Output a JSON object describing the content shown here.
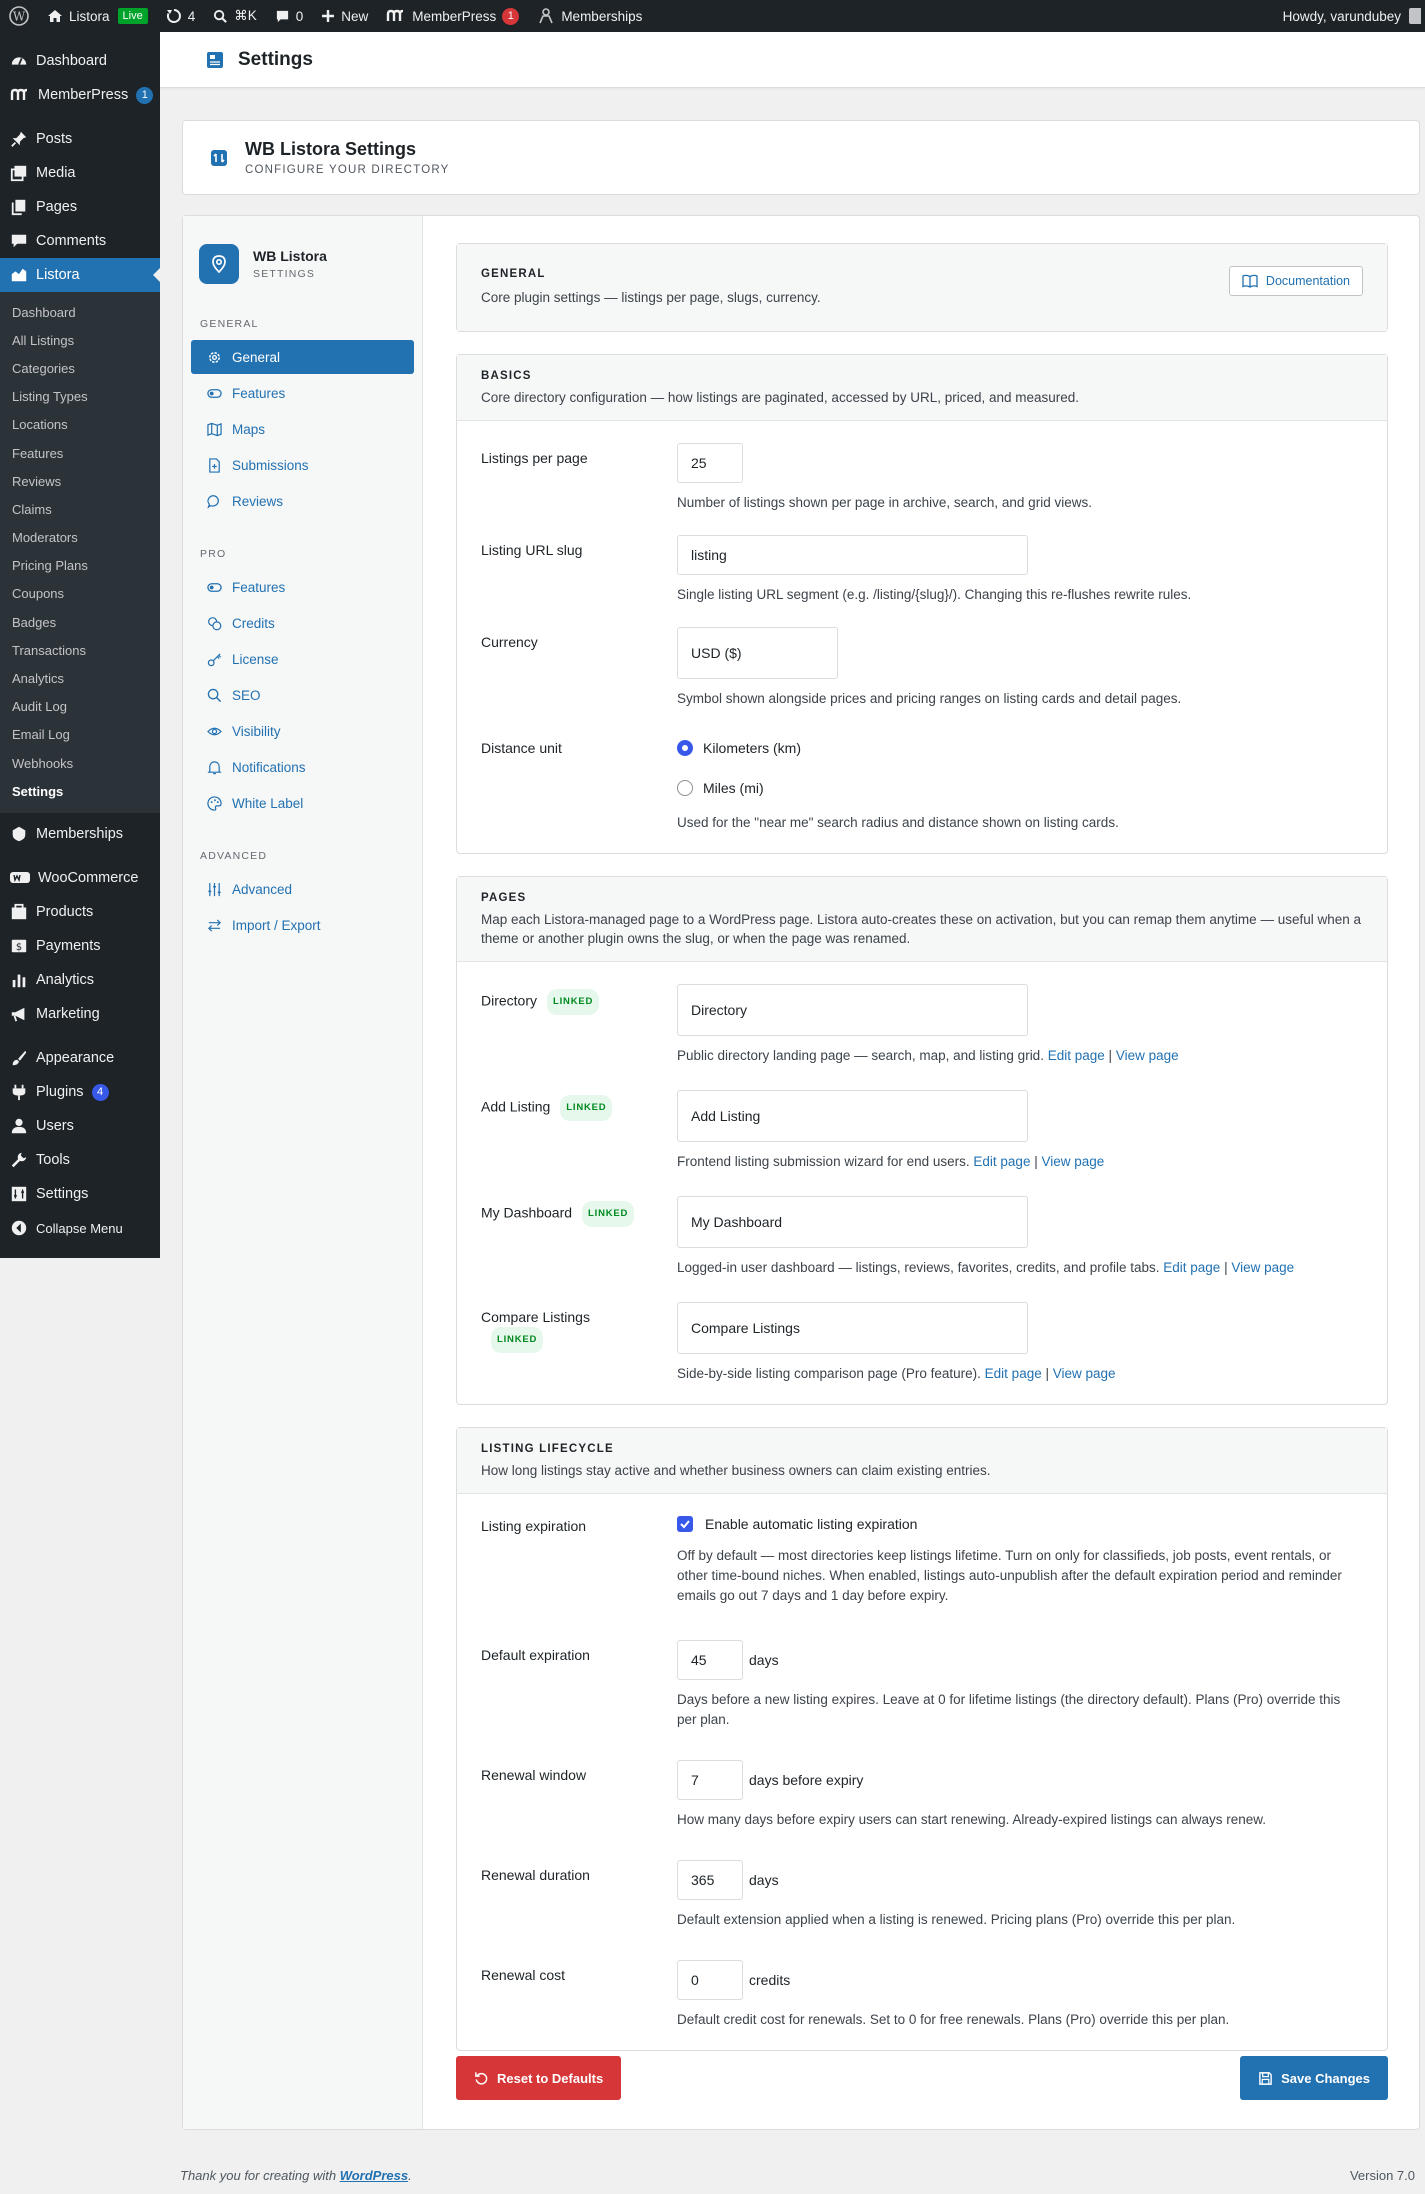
{
  "adminbar": {
    "site_name": "Listora",
    "live_label": "Live",
    "updates_count": "4",
    "search_shortcut": "⌘K",
    "comments_count": "0",
    "new_label": "New",
    "memberpress_label": "MemberPress",
    "memberpress_count": "1",
    "memberships_label": "Memberships",
    "howdy": "Howdy, varundubey"
  },
  "sidebar": {
    "top": [
      {
        "label": "Dashboard",
        "icon": "dashboard-icon"
      },
      {
        "label": "MemberPress",
        "icon": "memberpress-icon",
        "count": "1"
      }
    ],
    "group2": [
      {
        "label": "Posts",
        "icon": "pin-icon"
      },
      {
        "label": "Media",
        "icon": "media-icon"
      },
      {
        "label": "Pages",
        "icon": "pages-icon"
      },
      {
        "label": "Comments",
        "icon": "comment-icon"
      }
    ],
    "listora_label": "Listora",
    "listora_sub": [
      "Dashboard",
      "All Listings",
      "Categories",
      "Listing Types",
      "Locations",
      "Features",
      "Reviews",
      "Claims",
      "Moderators",
      "Pricing Plans",
      "Coupons",
      "Badges",
      "Transactions",
      "Analytics",
      "Audit Log",
      "Email Log",
      "Webhooks",
      "Settings"
    ],
    "current_sub": "Settings",
    "memberships_label": "Memberships",
    "group3": [
      {
        "label": "WooCommerce"
      },
      {
        "label": "Products"
      },
      {
        "label": "Payments"
      },
      {
        "label": "Analytics"
      },
      {
        "label": "Marketing"
      }
    ],
    "group4": [
      {
        "label": "Appearance"
      },
      {
        "label": "Plugins",
        "count": "4"
      },
      {
        "label": "Users"
      },
      {
        "label": "Tools"
      },
      {
        "label": "Settings"
      },
      {
        "label": "Collapse Menu"
      }
    ]
  },
  "page_title": "Settings",
  "plugin_header": {
    "title": "WB Listora Settings",
    "subtitle": "CONFIGURE YOUR DIRECTORY"
  },
  "settings_nav": {
    "title": "WB Listora",
    "subtitle": "SETTINGS",
    "groups": [
      {
        "label": "GENERAL",
        "items": [
          {
            "label": "General",
            "icon": "gear-icon"
          },
          {
            "label": "Features",
            "icon": "toggle-icon"
          },
          {
            "label": "Maps",
            "icon": "map-icon"
          },
          {
            "label": "Submissions",
            "icon": "document-icon"
          },
          {
            "label": "Reviews",
            "icon": "chat-icon"
          }
        ]
      },
      {
        "label": "PRO",
        "items": [
          {
            "label": "Features",
            "icon": "toggle-icon"
          },
          {
            "label": "Credits",
            "icon": "coins-icon"
          },
          {
            "label": "License",
            "icon": "key-icon"
          },
          {
            "label": "SEO",
            "icon": "search-icon"
          },
          {
            "label": "Visibility",
            "icon": "eye-icon"
          },
          {
            "label": "Notifications",
            "icon": "bell-icon"
          },
          {
            "label": "White Label",
            "icon": "palette-icon"
          }
        ]
      },
      {
        "label": "ADVANCED",
        "items": [
          {
            "label": "Advanced",
            "icon": "sliders-icon"
          },
          {
            "label": "Import / Export",
            "icon": "arrows-icon"
          }
        ]
      }
    ],
    "current": "General"
  },
  "general_card": {
    "title": "GENERAL",
    "desc": "Core plugin settings — listings per page, slugs, currency.",
    "doc_label": "Documentation"
  },
  "basics": {
    "title": "BASICS",
    "desc": "Core directory configuration — how listings are paginated, accessed by URL, priced, and measured.",
    "listings_per_page": {
      "label": "Listings per page",
      "value": "25",
      "help": "Number of listings shown per page in archive, search, and grid views."
    },
    "url_slug": {
      "label": "Listing URL slug",
      "value": "listing",
      "help": "Single listing URL segment (e.g. /listing/{slug}/). Changing this re-flushes rewrite rules."
    },
    "currency": {
      "label": "Currency",
      "value": "USD ($)",
      "help": "Symbol shown alongside prices and pricing ranges on listing cards and detail pages."
    },
    "distance": {
      "label": "Distance unit",
      "option_km": "Kilometers (km)",
      "option_mi": "Miles (mi)",
      "selected": "km",
      "help": "Used for the \"near me\" search radius and distance shown on listing cards."
    }
  },
  "pages": {
    "title": "PAGES",
    "desc": "Map each Listora-managed page to a WordPress page. Listora auto-creates these on activation, but you can remap them anytime — useful when a theme or another plugin owns the slug, or when the page was renamed.",
    "badge": "LINKED",
    "edit_link": "Edit page",
    "view_link": "View page",
    "separator": "|",
    "rows": [
      {
        "label": "Directory",
        "value": "Directory",
        "help": "Public directory landing page — search, map, and listing grid."
      },
      {
        "label": "Add Listing",
        "value": "Add Listing",
        "help": "Frontend listing submission wizard for end users."
      },
      {
        "label": "My Dashboard",
        "value": "My Dashboard",
        "help": "Logged-in user dashboard — listings, reviews, favorites, credits, and profile tabs."
      },
      {
        "label": "Compare Listings",
        "value": "Compare Listings",
        "help": "Side-by-side listing comparison page (Pro feature)."
      }
    ]
  },
  "lifecycle": {
    "title": "LISTING LIFECYCLE",
    "desc": "How long listings stay active and whether business owners can claim existing entries.",
    "expiration": {
      "label": "Listing expiration",
      "checkbox": "Enable automatic listing expiration",
      "checked": true,
      "help": "Off by default — most directories keep listings lifetime. Turn on only for classifieds, job posts, event rentals, or other time-bound niches. When enabled, listings auto-unpublish after the default expiration period and reminder emails go out 7 days and 1 day before expiry."
    },
    "default_expiration": {
      "label": "Default expiration",
      "value": "45",
      "unit": "days",
      "help": "Days before a new listing expires. Leave at 0 for lifetime listings (the directory default). Plans (Pro) override this per plan."
    },
    "renewal_window": {
      "label": "Renewal window",
      "value": "7",
      "unit": "days before expiry",
      "help": "How many days before expiry users can start renewing. Already-expired listings can always renew."
    },
    "renewal_duration": {
      "label": "Renewal duration",
      "value": "365",
      "unit": "days",
      "help": "Default extension applied when a listing is renewed. Pricing plans (Pro) override this per plan."
    },
    "renewal_cost": {
      "label": "Renewal cost",
      "value": "0",
      "unit": "credits",
      "help": "Default credit cost for renewals. Set to 0 for free renewals. Plans (Pro) override this per plan."
    }
  },
  "actions": {
    "reset": "Reset to Defaults",
    "save": "Save Changes"
  },
  "footer": {
    "thanks_prefix": "Thank you for creating with ",
    "wp_link": "WordPress",
    "thanks_suffix": ".",
    "version": "Version 7.0"
  },
  "colors": {
    "admin_dark": "#1d2327",
    "accent": "#2271b1",
    "danger": "#d63638",
    "linked_badge": "#008a20"
  }
}
